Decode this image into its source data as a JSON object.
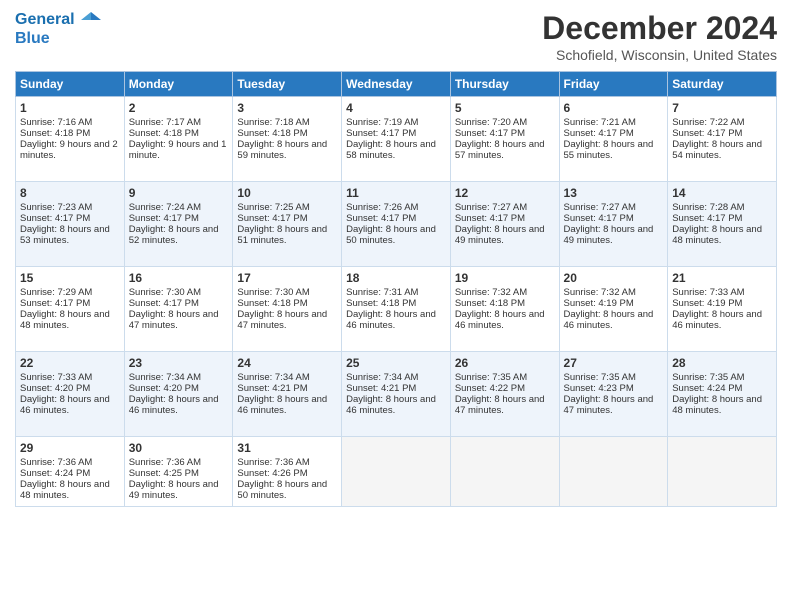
{
  "header": {
    "logo_line1": "General",
    "logo_line2": "Blue",
    "month_title": "December 2024",
    "location": "Schofield, Wisconsin, United States"
  },
  "days_of_week": [
    "Sunday",
    "Monday",
    "Tuesday",
    "Wednesday",
    "Thursday",
    "Friday",
    "Saturday"
  ],
  "weeks": [
    [
      {
        "day": "1",
        "sunrise": "Sunrise: 7:16 AM",
        "sunset": "Sunset: 4:18 PM",
        "daylight": "Daylight: 9 hours and 2 minutes."
      },
      {
        "day": "2",
        "sunrise": "Sunrise: 7:17 AM",
        "sunset": "Sunset: 4:18 PM",
        "daylight": "Daylight: 9 hours and 1 minute."
      },
      {
        "day": "3",
        "sunrise": "Sunrise: 7:18 AM",
        "sunset": "Sunset: 4:18 PM",
        "daylight": "Daylight: 8 hours and 59 minutes."
      },
      {
        "day": "4",
        "sunrise": "Sunrise: 7:19 AM",
        "sunset": "Sunset: 4:17 PM",
        "daylight": "Daylight: 8 hours and 58 minutes."
      },
      {
        "day": "5",
        "sunrise": "Sunrise: 7:20 AM",
        "sunset": "Sunset: 4:17 PM",
        "daylight": "Daylight: 8 hours and 57 minutes."
      },
      {
        "day": "6",
        "sunrise": "Sunrise: 7:21 AM",
        "sunset": "Sunset: 4:17 PM",
        "daylight": "Daylight: 8 hours and 55 minutes."
      },
      {
        "day": "7",
        "sunrise": "Sunrise: 7:22 AM",
        "sunset": "Sunset: 4:17 PM",
        "daylight": "Daylight: 8 hours and 54 minutes."
      }
    ],
    [
      {
        "day": "8",
        "sunrise": "Sunrise: 7:23 AM",
        "sunset": "Sunset: 4:17 PM",
        "daylight": "Daylight: 8 hours and 53 minutes."
      },
      {
        "day": "9",
        "sunrise": "Sunrise: 7:24 AM",
        "sunset": "Sunset: 4:17 PM",
        "daylight": "Daylight: 8 hours and 52 minutes."
      },
      {
        "day": "10",
        "sunrise": "Sunrise: 7:25 AM",
        "sunset": "Sunset: 4:17 PM",
        "daylight": "Daylight: 8 hours and 51 minutes."
      },
      {
        "day": "11",
        "sunrise": "Sunrise: 7:26 AM",
        "sunset": "Sunset: 4:17 PM",
        "daylight": "Daylight: 8 hours and 50 minutes."
      },
      {
        "day": "12",
        "sunrise": "Sunrise: 7:27 AM",
        "sunset": "Sunset: 4:17 PM",
        "daylight": "Daylight: 8 hours and 49 minutes."
      },
      {
        "day": "13",
        "sunrise": "Sunrise: 7:27 AM",
        "sunset": "Sunset: 4:17 PM",
        "daylight": "Daylight: 8 hours and 49 minutes."
      },
      {
        "day": "14",
        "sunrise": "Sunrise: 7:28 AM",
        "sunset": "Sunset: 4:17 PM",
        "daylight": "Daylight: 8 hours and 48 minutes."
      }
    ],
    [
      {
        "day": "15",
        "sunrise": "Sunrise: 7:29 AM",
        "sunset": "Sunset: 4:17 PM",
        "daylight": "Daylight: 8 hours and 48 minutes."
      },
      {
        "day": "16",
        "sunrise": "Sunrise: 7:30 AM",
        "sunset": "Sunset: 4:17 PM",
        "daylight": "Daylight: 8 hours and 47 minutes."
      },
      {
        "day": "17",
        "sunrise": "Sunrise: 7:30 AM",
        "sunset": "Sunset: 4:18 PM",
        "daylight": "Daylight: 8 hours and 47 minutes."
      },
      {
        "day": "18",
        "sunrise": "Sunrise: 7:31 AM",
        "sunset": "Sunset: 4:18 PM",
        "daylight": "Daylight: 8 hours and 46 minutes."
      },
      {
        "day": "19",
        "sunrise": "Sunrise: 7:32 AM",
        "sunset": "Sunset: 4:18 PM",
        "daylight": "Daylight: 8 hours and 46 minutes."
      },
      {
        "day": "20",
        "sunrise": "Sunrise: 7:32 AM",
        "sunset": "Sunset: 4:19 PM",
        "daylight": "Daylight: 8 hours and 46 minutes."
      },
      {
        "day": "21",
        "sunrise": "Sunrise: 7:33 AM",
        "sunset": "Sunset: 4:19 PM",
        "daylight": "Daylight: 8 hours and 46 minutes."
      }
    ],
    [
      {
        "day": "22",
        "sunrise": "Sunrise: 7:33 AM",
        "sunset": "Sunset: 4:20 PM",
        "daylight": "Daylight: 8 hours and 46 minutes."
      },
      {
        "day": "23",
        "sunrise": "Sunrise: 7:34 AM",
        "sunset": "Sunset: 4:20 PM",
        "daylight": "Daylight: 8 hours and 46 minutes."
      },
      {
        "day": "24",
        "sunrise": "Sunrise: 7:34 AM",
        "sunset": "Sunset: 4:21 PM",
        "daylight": "Daylight: 8 hours and 46 minutes."
      },
      {
        "day": "25",
        "sunrise": "Sunrise: 7:34 AM",
        "sunset": "Sunset: 4:21 PM",
        "daylight": "Daylight: 8 hours and 46 minutes."
      },
      {
        "day": "26",
        "sunrise": "Sunrise: 7:35 AM",
        "sunset": "Sunset: 4:22 PM",
        "daylight": "Daylight: 8 hours and 47 minutes."
      },
      {
        "day": "27",
        "sunrise": "Sunrise: 7:35 AM",
        "sunset": "Sunset: 4:23 PM",
        "daylight": "Daylight: 8 hours and 47 minutes."
      },
      {
        "day": "28",
        "sunrise": "Sunrise: 7:35 AM",
        "sunset": "Sunset: 4:24 PM",
        "daylight": "Daylight: 8 hours and 48 minutes."
      }
    ],
    [
      {
        "day": "29",
        "sunrise": "Sunrise: 7:36 AM",
        "sunset": "Sunset: 4:24 PM",
        "daylight": "Daylight: 8 hours and 48 minutes."
      },
      {
        "day": "30",
        "sunrise": "Sunrise: 7:36 AM",
        "sunset": "Sunset: 4:25 PM",
        "daylight": "Daylight: 8 hours and 49 minutes."
      },
      {
        "day": "31",
        "sunrise": "Sunrise: 7:36 AM",
        "sunset": "Sunset: 4:26 PM",
        "daylight": "Daylight: 8 hours and 50 minutes."
      },
      null,
      null,
      null,
      null
    ]
  ]
}
